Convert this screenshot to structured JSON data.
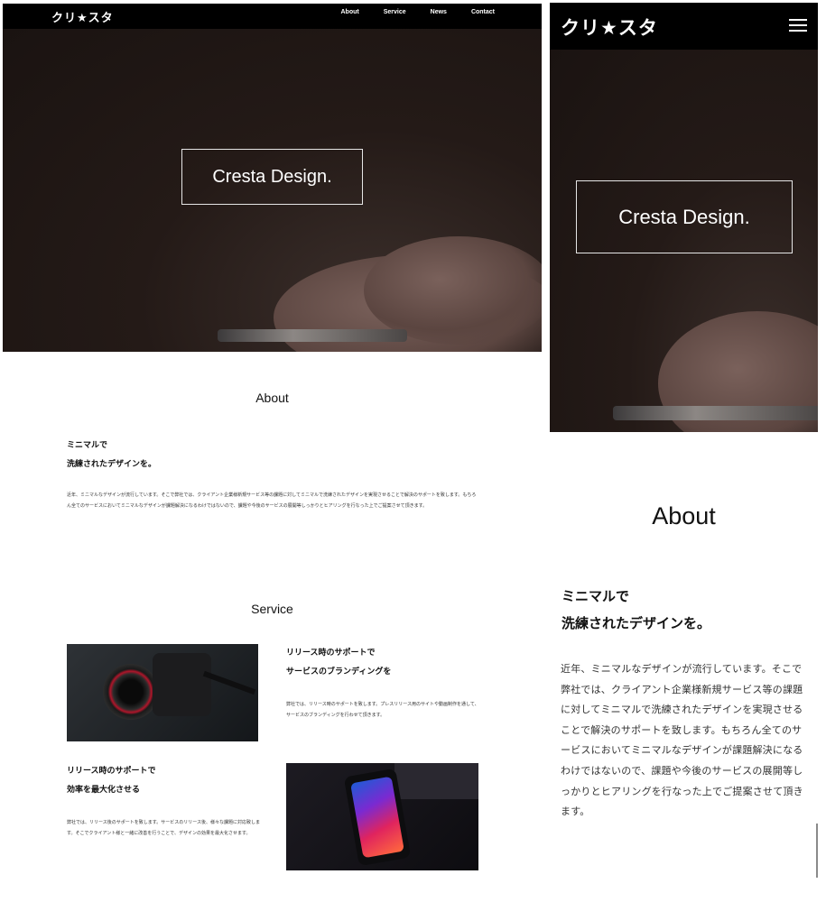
{
  "brand": {
    "logo": "クリ★スタ"
  },
  "nav": {
    "items": [
      "About",
      "Service",
      "News",
      "Contact"
    ]
  },
  "hero": {
    "title": "Cresta Design."
  },
  "about": {
    "title": "About",
    "heading_line1": "ミニマルで",
    "heading_line2": "洗練されたデザインを。",
    "body": "近年、ミニマルなデザインが流行しています。そこで弊社では、クライアント企業様新規サービス等の課題に対してミニマルで洗練されたデザインを実現させることで解決のサポートを致します。もちろん全てのサービスにおいてミニマルなデザインが課題解決になるわけではないので、課題や今後のサービスの展開等しっかりとヒアリングを行なった上でご提案させて頂きます。"
  },
  "service": {
    "title": "Service",
    "items": [
      {
        "heading_line1": "リリース時のサポートで",
        "heading_line2": "サービスのブランディングを",
        "body": "弊社では、リリース時のサポートを致します。プレスリリース用のサイトや動画制作を通して、サービスのブランディングを行わせて頂きます。",
        "image_icon": "camera-image"
      },
      {
        "heading_line1": "リリース時のサポートで",
        "heading_line2": "効率を最大化させる",
        "body": "弊社では、リリース後のサポートを致します。サービスのリリース後、様々な課題に対応致します。そこでクライアント様と一緒に改善を行うことで、デザインの効果を最大化させます。",
        "image_icon": "smartphone-image"
      }
    ]
  },
  "mobile": {
    "menu_icon": "hamburger-icon"
  }
}
